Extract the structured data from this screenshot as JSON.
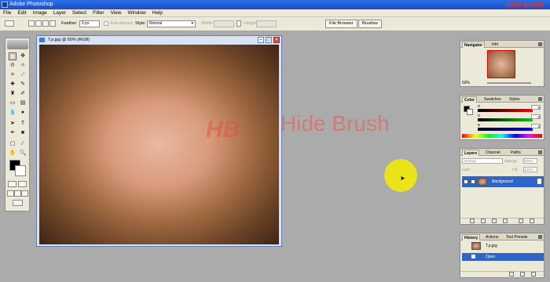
{
  "window": {
    "title": "Adobe Photoshop",
    "logo_text": "Hide Brush"
  },
  "menu": [
    "File",
    "Edit",
    "Image",
    "Layer",
    "Select",
    "Filter",
    "View",
    "Window",
    "Help"
  ],
  "options_bar": {
    "feather_label": "Feather:",
    "feather_value": "0 px",
    "antialiased_label": "Anti-aliased",
    "style_label": "Style:",
    "style_value": "Normal",
    "width_label": "Width:",
    "height_label": "Height:",
    "tabs": [
      "File Browser",
      "Brushes"
    ]
  },
  "document": {
    "title": "T.p.jpg @ 50% (RGB)",
    "watermark": "Hide Brush",
    "watermark_mark": "HB"
  },
  "navigator": {
    "tabs": [
      "Navigator",
      "Info"
    ],
    "zoom": "50%"
  },
  "color": {
    "tabs": [
      "Color",
      "Swatches",
      "Styles"
    ],
    "channels": [
      {
        "label": "R",
        "value": "0"
      },
      {
        "label": "G",
        "value": "0"
      },
      {
        "label": "B",
        "value": "0"
      }
    ]
  },
  "layers": {
    "tabs": [
      "Layers",
      "Channel",
      "Paths"
    ],
    "blend_mode": "Normal",
    "opacity_label": "Opacity:",
    "opacity_value": "100%",
    "lock_label": "Lock:",
    "fill_label": "Fill:",
    "fill_value": "100%",
    "layer_name": "Background"
  },
  "history": {
    "tabs": [
      "History",
      "Actions",
      "Tool Presets"
    ],
    "items": [
      "T.p.jpg",
      "Open"
    ]
  },
  "colors": {
    "title_bar": "#1b4fc9",
    "selection": "#2f64c8",
    "cursor_highlight": "#f5ec00",
    "watermark": "#d9736a"
  }
}
